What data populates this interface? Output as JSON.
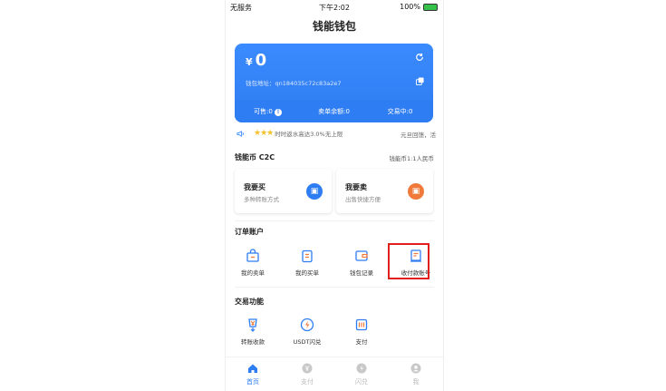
{
  "status_bar": {
    "carrier": "无服务",
    "time": "下午2:02",
    "battery": "100%"
  },
  "page_title": "钱能钱包",
  "wallet_card": {
    "currency_symbol": "¥",
    "balance": "0",
    "address_label": "钱包地址：qn184035c72c83a2e7",
    "stats": [
      "可售:0",
      "卖单余额:0",
      "交易中:0"
    ]
  },
  "notice": {
    "text": "时时返水高达3.0%无上限",
    "right_text": "元旦回馈，活"
  },
  "c2c": {
    "title": "钱能币 C2C",
    "rate": "钱能币1:1人民币",
    "buy": {
      "title": "我要买",
      "subtitle": "多种转账方式"
    },
    "sell": {
      "title": "我要卖",
      "subtitle": "出售快捷方便"
    }
  },
  "orders": {
    "title": "订单账户",
    "items": [
      "我的卖单",
      "我的买单",
      "钱包记录",
      "收付款账号"
    ]
  },
  "trade": {
    "title": "交易功能",
    "items": [
      "转账收款",
      "USDT闪兑",
      "支付"
    ]
  },
  "tabbar": {
    "items": [
      "首页",
      "支付",
      "闪兑",
      "我"
    ],
    "active_index": 0
  },
  "colors": {
    "accent": "#2f7df3",
    "highlight": "#e01f1f",
    "sell": "#f07a3b"
  }
}
